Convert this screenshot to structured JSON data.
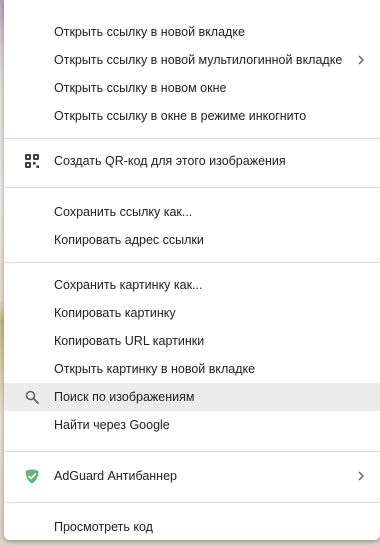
{
  "menu": {
    "group1": {
      "open_new_tab": "Открыть ссылку в новой вкладке",
      "open_multilogin_tab": "Открыть ссылку в новой мультилогинной вкладке",
      "open_new_window": "Открыть ссылку в новом окне",
      "open_incognito": "Открыть ссылку в окне в режиме инкогнито"
    },
    "group2": {
      "create_qr": "Создать QR-код для этого изображения"
    },
    "group3": {
      "save_link_as": "Сохранить ссылку как...",
      "copy_link_address": "Копировать адрес ссылки"
    },
    "group4": {
      "save_image_as": "Сохранить картинку как...",
      "copy_image": "Копировать картинку",
      "copy_image_url": "Копировать URL картинки",
      "open_image_new_tab": "Открыть картинку в новой вкладке",
      "search_by_image": "Поиск по изображениям",
      "find_via_google": "Найти через Google"
    },
    "group5": {
      "adguard": "AdGuard Антибаннер"
    },
    "group6": {
      "inspect": "Просмотреть код"
    }
  },
  "icons": {
    "qr": "qr-code-icon",
    "search": "search-icon",
    "adguard": "adguard-shield-icon",
    "submenu": "chevron-right-icon"
  },
  "colors": {
    "highlight": "#ececec",
    "adguard_green": "#67b279",
    "text": "#202124",
    "separator": "#dadce0"
  }
}
